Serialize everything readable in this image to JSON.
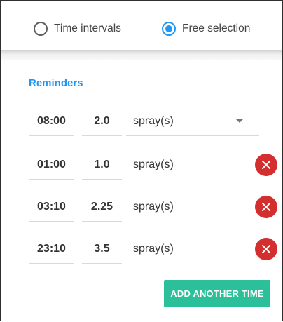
{
  "mode_selector": {
    "options": [
      {
        "label": "Time intervals",
        "checked": false
      },
      {
        "label": "Free selection",
        "checked": true
      }
    ]
  },
  "reminders": {
    "title": "Reminders",
    "rows": [
      {
        "time": "08:00",
        "amount": "2.0",
        "unit": "spray(s)"
      },
      {
        "time": "01:00",
        "amount": "1.0",
        "unit": "spray(s)"
      },
      {
        "time": "03:10",
        "amount": "2.25",
        "unit": "spray(s)"
      },
      {
        "time": "23:10",
        "amount": "3.5",
        "unit": "spray(s)"
      }
    ],
    "add_button_label": "ADD ANOTHER TIME"
  },
  "colors": {
    "accent": "#2196f3",
    "remove": "#d32f2f",
    "add_button": "#2bbf9a"
  },
  "icons": {
    "remove": "close-icon",
    "unit_dropdown": "chevron-down-icon"
  }
}
